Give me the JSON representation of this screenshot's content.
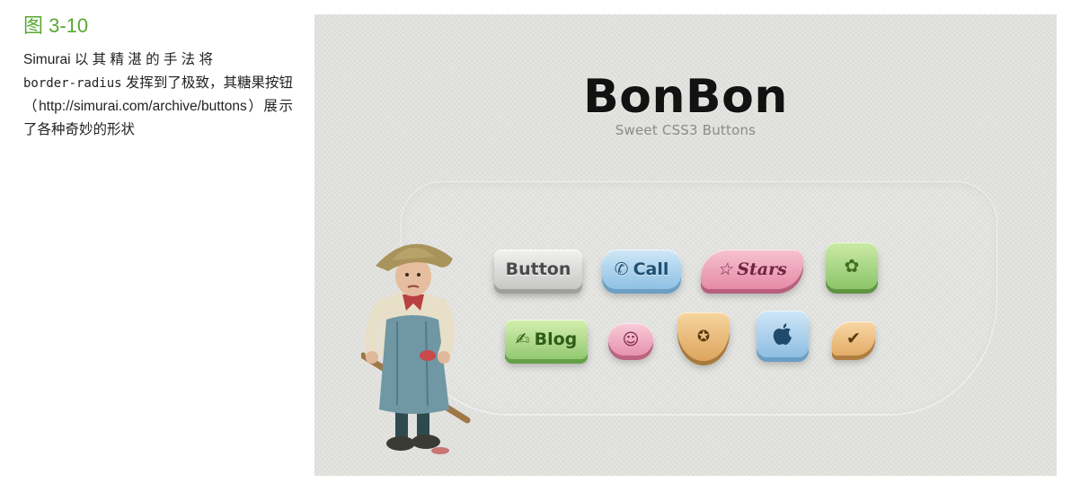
{
  "caption": {
    "figure_label": "图 3-10",
    "desc_part1": "Simurai 以 其 精 湛 的 手 法 将",
    "desc_code": "border-radius",
    "desc_part2": " 发挥到了极致，其糖果按钮（http://simurai.com/archive/buttons）展示了各种奇妙的形状"
  },
  "screenshot": {
    "title": "BonBon",
    "subtitle": "Sweet CSS3 Buttons",
    "buttons": {
      "button_label": "Button",
      "call_label": "Call",
      "stars_label": "Stars",
      "blog_label": "Blog"
    },
    "icons": {
      "call": "✆",
      "star": "☆",
      "flower": "✿",
      "pencil": "✍",
      "smile": "☺",
      "shield_star": "✪",
      "apple": "",
      "check": "✔"
    },
    "colors": {
      "grey": "#c7c7c5",
      "blue": "#8fc1e3",
      "pink": "#e58aa7",
      "green": "#8cc56a",
      "orange": "#dca55c"
    }
  }
}
